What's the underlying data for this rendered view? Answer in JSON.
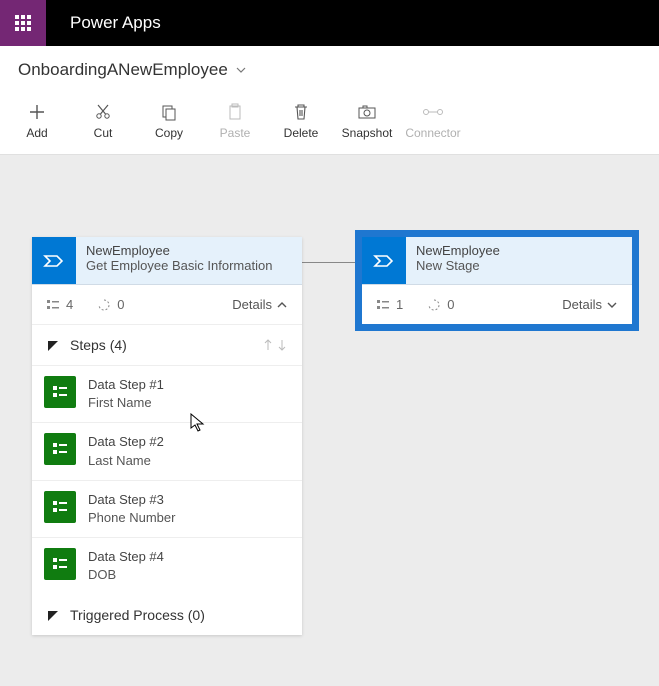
{
  "app_title": "Power Apps",
  "breadcrumb": "OnboardingANewEmployee",
  "toolbar": {
    "add": "Add",
    "cut": "Cut",
    "copy": "Copy",
    "paste": "Paste",
    "delete": "Delete",
    "snapshot": "Snapshot",
    "connector": "Connector"
  },
  "card1": {
    "title_line1": "NewEmployee",
    "title_line2": "Get Employee Basic Information",
    "count_steps": "4",
    "count_other": "0",
    "details": "Details",
    "section_steps": "Steps (4)",
    "section_triggered": "Triggered Process (0)",
    "steps": [
      {
        "line1": "Data Step #1",
        "line2": "First Name"
      },
      {
        "line1": "Data Step #2",
        "line2": "Last Name"
      },
      {
        "line1": "Data Step #3",
        "line2": "Phone Number"
      },
      {
        "line1": "Data Step #4",
        "line2": "DOB"
      }
    ]
  },
  "card2": {
    "title_line1": "NewEmployee",
    "title_line2": "New Stage",
    "count_steps": "1",
    "count_other": "0",
    "details": "Details"
  }
}
